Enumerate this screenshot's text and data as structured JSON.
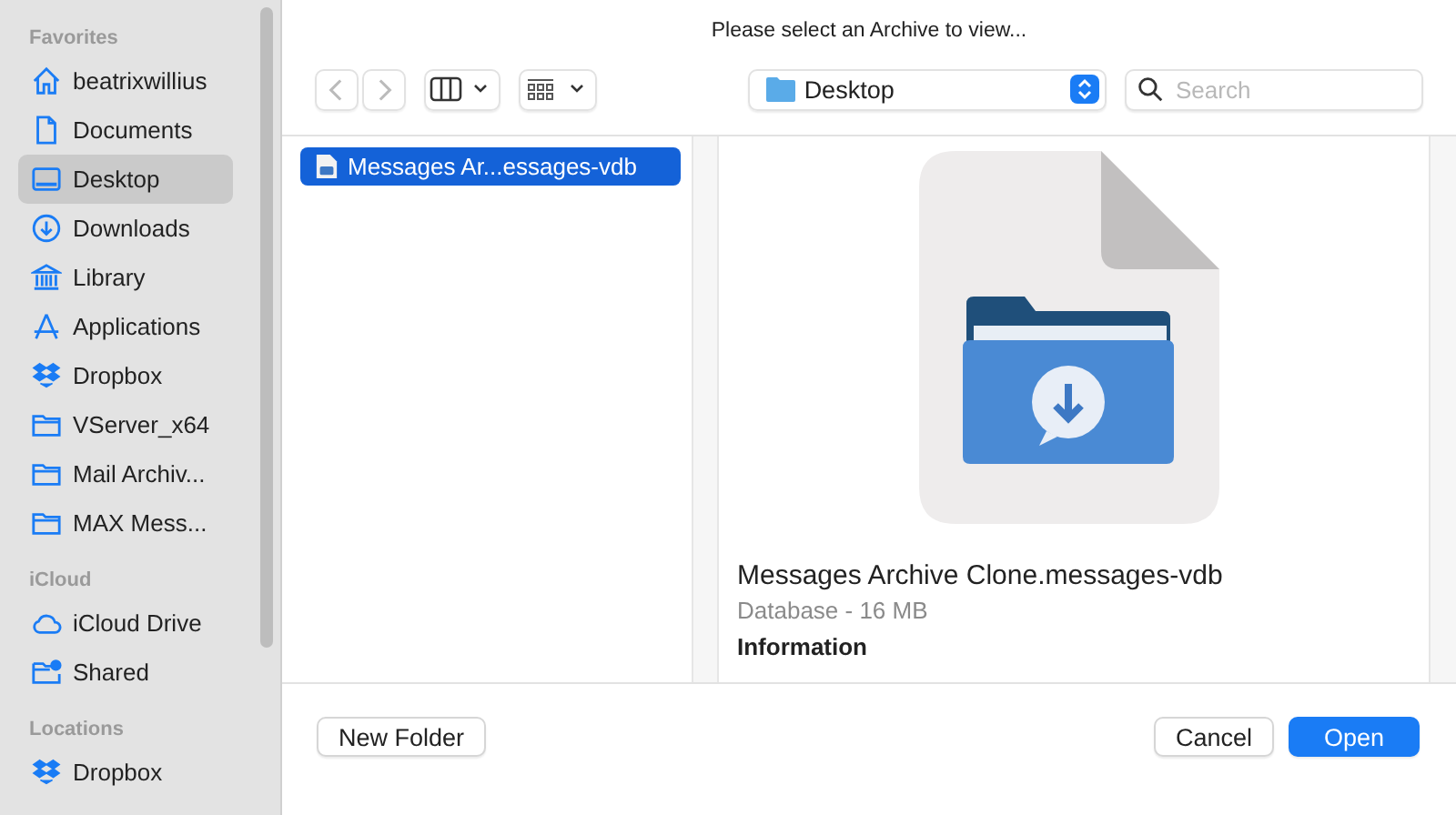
{
  "sidebar": {
    "sections": [
      {
        "title": "Favorites",
        "items": [
          {
            "label": "beatrixwillius",
            "kind": "home",
            "selected": false
          },
          {
            "label": "Documents",
            "kind": "document",
            "selected": false
          },
          {
            "label": "Desktop",
            "kind": "desktop",
            "selected": true
          },
          {
            "label": "Downloads",
            "kind": "download",
            "selected": false
          },
          {
            "label": "Library",
            "kind": "library",
            "selected": false
          },
          {
            "label": "Applications",
            "kind": "apps",
            "selected": false
          },
          {
            "label": "Dropbox",
            "kind": "dropbox",
            "selected": false
          },
          {
            "label": "VServer_x64",
            "kind": "folder",
            "selected": false
          },
          {
            "label": "Mail Archiv...",
            "kind": "folder",
            "selected": false
          },
          {
            "label": "MAX Mess...",
            "kind": "folder",
            "selected": false
          }
        ]
      },
      {
        "title": "iCloud",
        "items": [
          {
            "label": "iCloud Drive",
            "kind": "cloud",
            "selected": false
          },
          {
            "label": "Shared",
            "kind": "shared",
            "selected": false
          }
        ]
      },
      {
        "title": "Locations",
        "items": [
          {
            "label": "Dropbox",
            "kind": "dropbox",
            "selected": false
          }
        ]
      }
    ]
  },
  "dialog_title": "Please select an Archive to view...",
  "toolbar": {
    "location": "Desktop",
    "search": {
      "placeholder": "Search"
    }
  },
  "files": [
    {
      "name": "Messages Ar...essages-vdb",
      "selected": true
    }
  ],
  "preview": {
    "name": "Messages Archive Clone.messages-vdb",
    "info": "Database - 16 MB",
    "section": "Information"
  },
  "buttons": {
    "new_folder": "New Folder",
    "cancel": "Cancel",
    "open": "Open"
  }
}
